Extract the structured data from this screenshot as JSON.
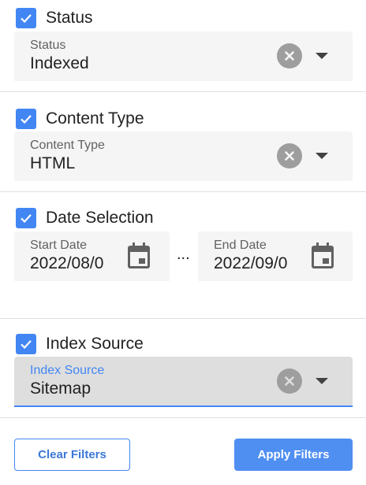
{
  "sections": {
    "status": {
      "checkbox_label": "Status",
      "checked": true,
      "field_label": "Status",
      "field_value": "Indexed"
    },
    "content_type": {
      "checkbox_label": "Content Type",
      "checked": true,
      "field_label": "Content Type",
      "field_value": "HTML"
    },
    "date_selection": {
      "checkbox_label": "Date Selection",
      "checked": true,
      "start": {
        "label": "Start Date",
        "value": "2022/08/0"
      },
      "separator": "...",
      "end": {
        "label": "End Date",
        "value": "2022/09/0"
      }
    },
    "index_source": {
      "checkbox_label": "Index Source",
      "checked": true,
      "field_label": "Index Source",
      "field_value": "Sitemap"
    }
  },
  "actions": {
    "clear_label": "Clear Filters",
    "apply_label": "Apply Filters"
  },
  "icons": {
    "check": "check-icon",
    "clear": "clear-icon",
    "dropdown": "chevron-down-icon",
    "calendar": "calendar-icon"
  },
  "colors": {
    "accent": "#4286f4",
    "field_bg": "#f5f5f5",
    "field_active_bg": "#dedede",
    "clear_icon": "#9e9e9e",
    "apply_button": "#4f8ff2"
  }
}
